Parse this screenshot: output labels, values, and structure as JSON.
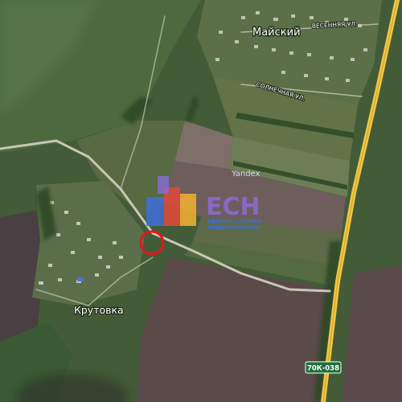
{
  "map": {
    "places": {
      "maisky": "Майский",
      "krutovka": "Крутовка"
    },
    "streets": {
      "vesennyaya": "ВЕСЕННЯЯ УЛ.",
      "solnechnaya": "СОЛНЕЧНАЯ УЛ."
    },
    "highway_shield": "70К-038",
    "provider_watermark": "Yandex",
    "marker_color": "#e8141b",
    "highway_color": "#f2c640"
  },
  "brand_logo": {
    "letters": "ЕСН",
    "line1": "ЕДИНАЯ СЛУЖБА",
    "line2": "НЕДВИЖИМОСТИ",
    "colors": [
      "#3d6fd8",
      "#e2493a",
      "#f3b233",
      "#8b6bd6"
    ]
  }
}
